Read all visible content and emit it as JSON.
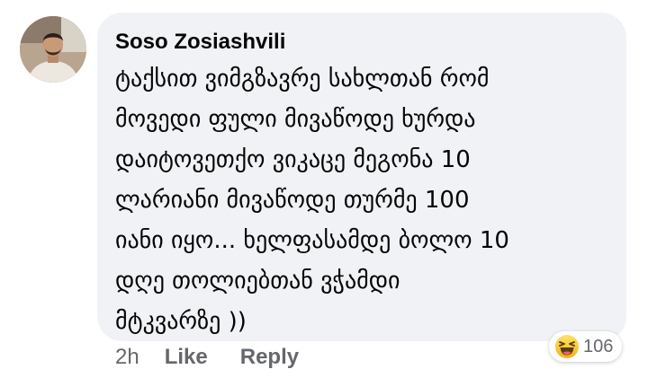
{
  "comment": {
    "author": "Soso Zosiashvili",
    "lines": [
      "ტაქსით ვიმგზავრე სახლთან რომ",
      "მოვედი ფული მივაწოდე ხურდა",
      "დაიტოვეთქო ვიკაცე მეგონა 10",
      "ლარიანი მივაწოდე თურმე 100",
      "იანი იყო... ხელფასამდე ბოლო 10",
      "დღე  თოლიებთან ვჭამდი",
      "მტკვარზე ))"
    ]
  },
  "actions": {
    "timestamp": "2h",
    "like_label": "Like",
    "reply_label": "Reply"
  },
  "reactions": {
    "icon": "haha-emoji-icon",
    "count": "106"
  },
  "colors": {
    "bubble_bg": "#f0f2f5",
    "text": "#050505",
    "secondary_text": "#65676b"
  }
}
